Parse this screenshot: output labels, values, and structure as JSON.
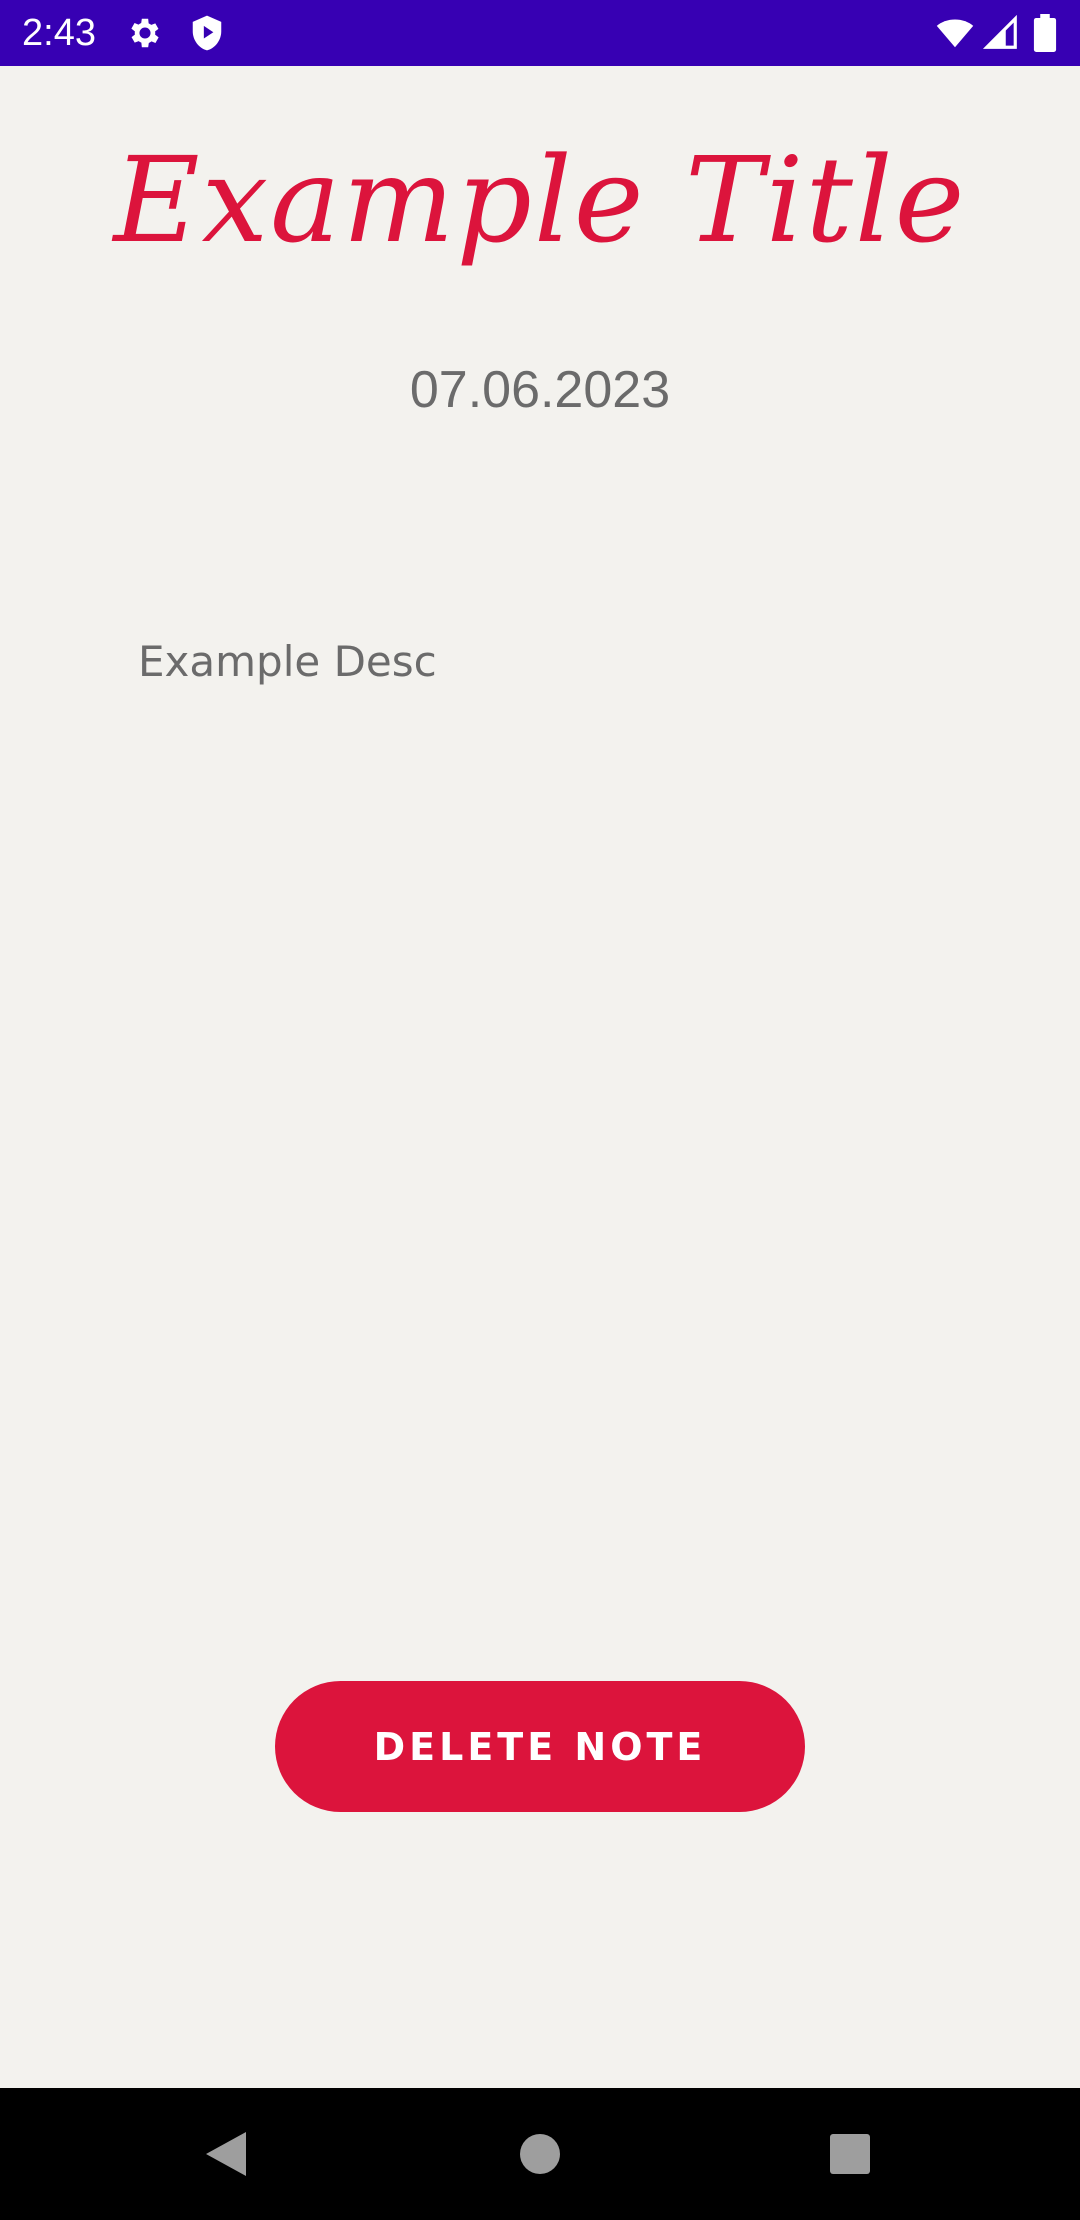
{
  "status_bar": {
    "time": "2:43",
    "icons": [
      "gear-icon",
      "shield-play-icon",
      "wifi-icon",
      "signal-icon",
      "battery-icon"
    ],
    "background": "#3700b3"
  },
  "note": {
    "title": "Example Title",
    "date": "07.06.2023",
    "description": "Example Desc"
  },
  "actions": {
    "delete_label": "DELETE NOTE"
  },
  "nav_bar": {
    "buttons": [
      "back-icon",
      "home-icon",
      "recents-icon"
    ]
  },
  "colors": {
    "accent": "#dc143c",
    "background": "#f3f2ee",
    "secondary_text": "#6b6b6b"
  }
}
